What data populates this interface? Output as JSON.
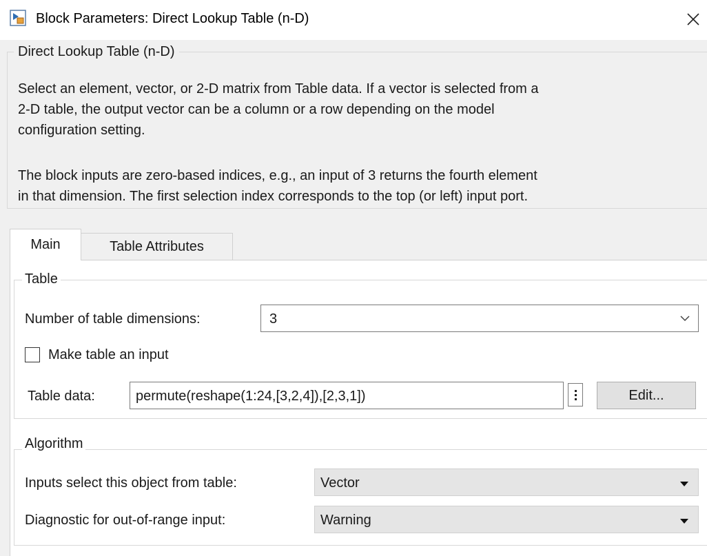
{
  "window": {
    "title": "Block Parameters: Direct Lookup Table (n-D)",
    "close_icon": "close-icon",
    "app_icon": "simulink-block-icon"
  },
  "description": {
    "group_title": "Direct Lookup Table (n-D)",
    "paragraph_1_lines": [
      "Select an element, vector, or 2-D matrix from Table data. If a vector is selected from a",
      "2-D table, the output vector can be a column or a row depending on the model",
      "configuration setting."
    ],
    "paragraph_2_lines": [
      "The block inputs are zero-based indices, e.g., an input of 3 returns the fourth element",
      "in that dimension. The first selection index corresponds to the top (or left) input port."
    ]
  },
  "tabs": [
    {
      "label": "Main",
      "active": true
    },
    {
      "label": "Table Attributes",
      "active": false
    }
  ],
  "table_group": {
    "title": "Table",
    "num_dims_label": "Number of table dimensions:",
    "num_dims_value": "3",
    "make_input_label": "Make table an input",
    "make_input_checked": false,
    "table_data_label": "Table data:",
    "table_data_value": "permute(reshape(1:24,[3,2,4]),[2,3,1])",
    "edit_button": "Edit..."
  },
  "algorithm_group": {
    "title": "Algorithm",
    "inputs_select_label": "Inputs select this object from table:",
    "inputs_select_value": "Vector",
    "diagnostic_label": "Diagnostic for out-of-range input:",
    "diagnostic_value": "Warning"
  }
}
